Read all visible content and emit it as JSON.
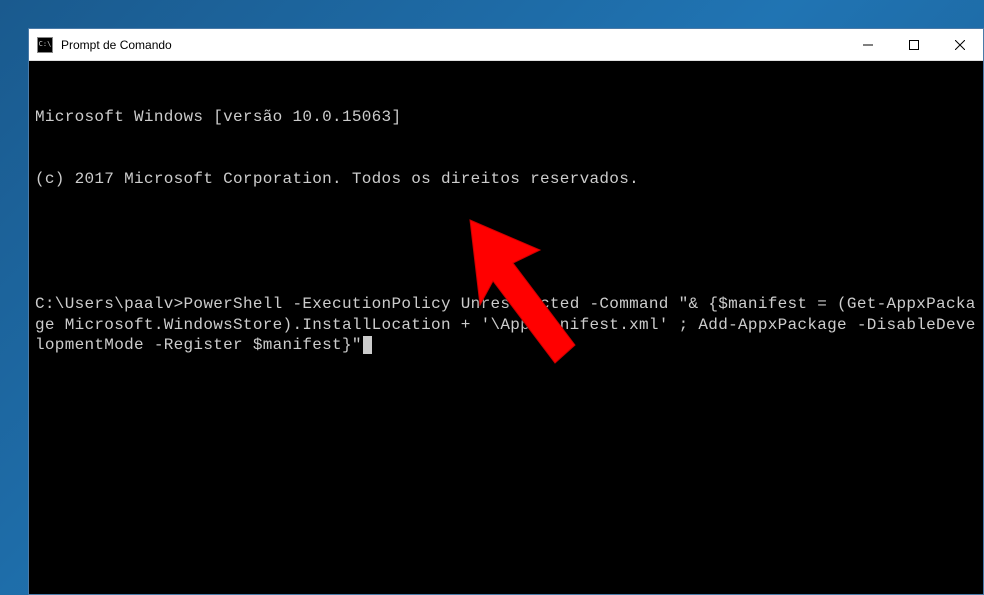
{
  "window": {
    "title": "Prompt de Comando",
    "icon_text": "C:\\"
  },
  "terminal": {
    "header_line1": "Microsoft Windows [versão 10.0.15063]",
    "header_line2": "(c) 2017 Microsoft Corporation. Todos os direitos reservados.",
    "prompt": "C:\\Users\\paalv>",
    "command": "PowerShell -ExecutionPolicy Unrestricted -Command \"& {$manifest = (Get-AppxPackage Microsoft.WindowsStore).InstallLocation + '\\AppxManifest.xml' ; Add-AppxPackage -DisableDevelopmentMode -Register $manifest}\""
  },
  "controls": {
    "minimize": "minimize",
    "maximize": "maximize",
    "close": "close"
  }
}
